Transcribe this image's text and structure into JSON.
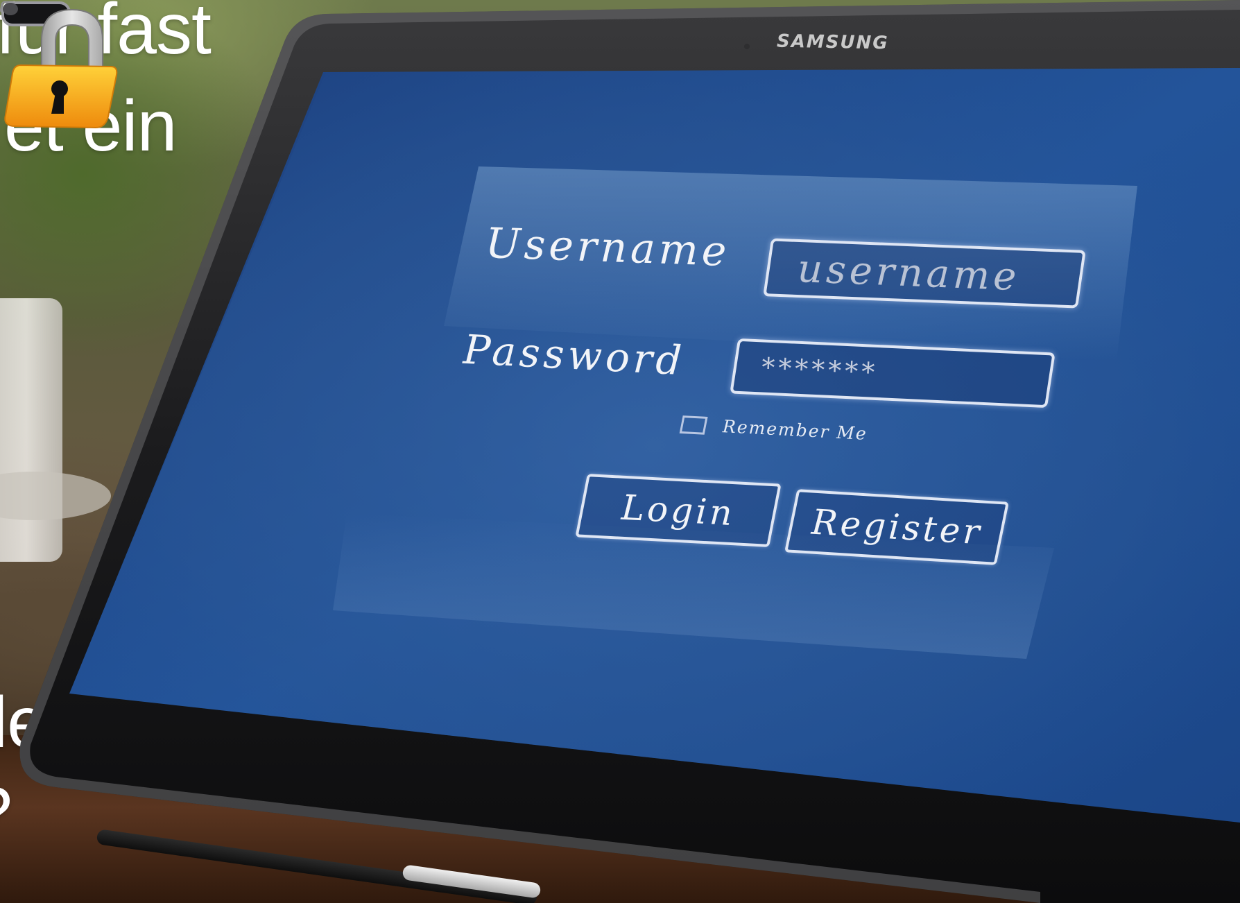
{
  "overlay_text": {
    "line1": "für fast",
    "line2": "et ein",
    "line3": ")",
    "line4": "le",
    "line5": "?"
  },
  "device": {
    "brand": "SAMSUNG"
  },
  "login_form": {
    "username_label": "Username",
    "username_value": "username",
    "password_label": "Password",
    "password_value": "*******",
    "remember_label": "Remember Me",
    "remember_checked": false,
    "login_button": "Login",
    "register_button": "Register"
  },
  "icons": {
    "padlock": "padlock-icon",
    "home": "home-button-icon",
    "back": "back-key-icon",
    "menu": "menu-key-icon"
  },
  "colors": {
    "screen_blue": "#1f4a8f",
    "screen_glow": "#4f7bb5",
    "padlock_body": "#f2a51a",
    "padlock_shackle": "#c8c8c8",
    "bezel": "#1a1a1c"
  }
}
